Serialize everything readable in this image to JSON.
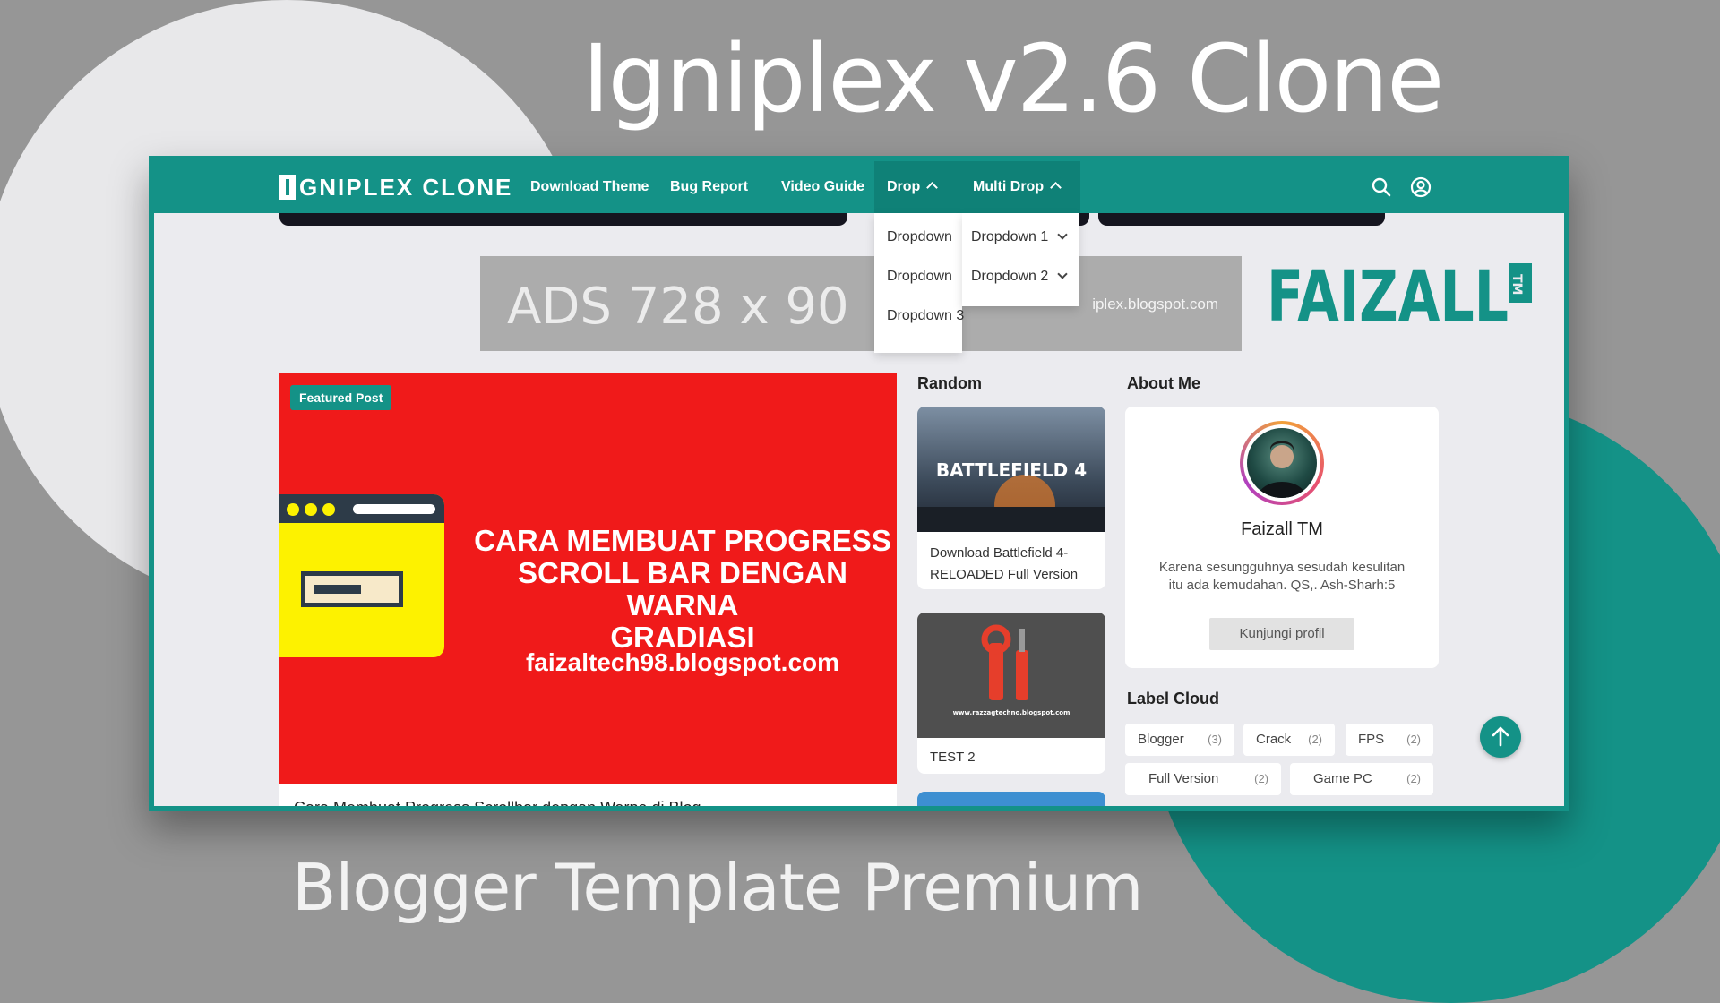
{
  "hero": {
    "title": "Igniplex v2.6 Clone",
    "subtitle": "Blogger Template Premium"
  },
  "nav": {
    "brand": "GNIPLEX CLONE",
    "items": [
      "Download Theme",
      "Bug Report",
      "Video Guide",
      "Drop",
      "Multi Drop"
    ],
    "search_icon": "search-icon",
    "user_icon": "user-circle-icon"
  },
  "dropdowns": {
    "drop": [
      "Dropdown",
      "Dropdown",
      "Dropdown 3"
    ],
    "multi_drop": [
      "Dropdown 1",
      "Dropdown 2"
    ]
  },
  "ads": {
    "text": "ADS  728 x 90",
    "url": "iplex.blogspot.com"
  },
  "featured": {
    "badge": "Featured Post",
    "headline_lines": [
      "CARA MEMBUAT PROGRESS",
      "SCROLL BAR DENGAN WARNA",
      "GRADIASI"
    ],
    "url": "faizaltech98.blogspot.com",
    "caption": "Cara Membuat Progress Scrollbar dengan Warna di Blog"
  },
  "random": {
    "title": "Random",
    "cards": [
      {
        "image_text": "BATTLEFIELD 4",
        "line1": "Download Battlefield 4-",
        "line2": "RELOADED Full Version"
      },
      {
        "image_text": "www.razzagtechno.blogspot.com",
        "line1": "TEST 2",
        "line2": ""
      }
    ]
  },
  "about": {
    "title": "About Me",
    "name": "Faizall TM",
    "desc_line1": "Karena sesungguhnya sesudah kesulitan",
    "desc_line2": "itu ada kemudahan. QS,. Ash-Sharh:5",
    "button": "Kunjungi profil"
  },
  "labels": {
    "title": "Label Cloud",
    "tags": [
      {
        "name": "Blogger",
        "count": "(3)"
      },
      {
        "name": "Crack",
        "count": "(2)"
      },
      {
        "name": "FPS",
        "count": "(2)"
      },
      {
        "name": "Full Version",
        "count": "(2)"
      },
      {
        "name": "Game PC",
        "count": "(2)"
      }
    ]
  },
  "logo_text": "FAIZALL",
  "logo_tag": "TM",
  "colors": {
    "accent": "#149287",
    "background": "#969696",
    "featured_red": "#f01a1a"
  }
}
